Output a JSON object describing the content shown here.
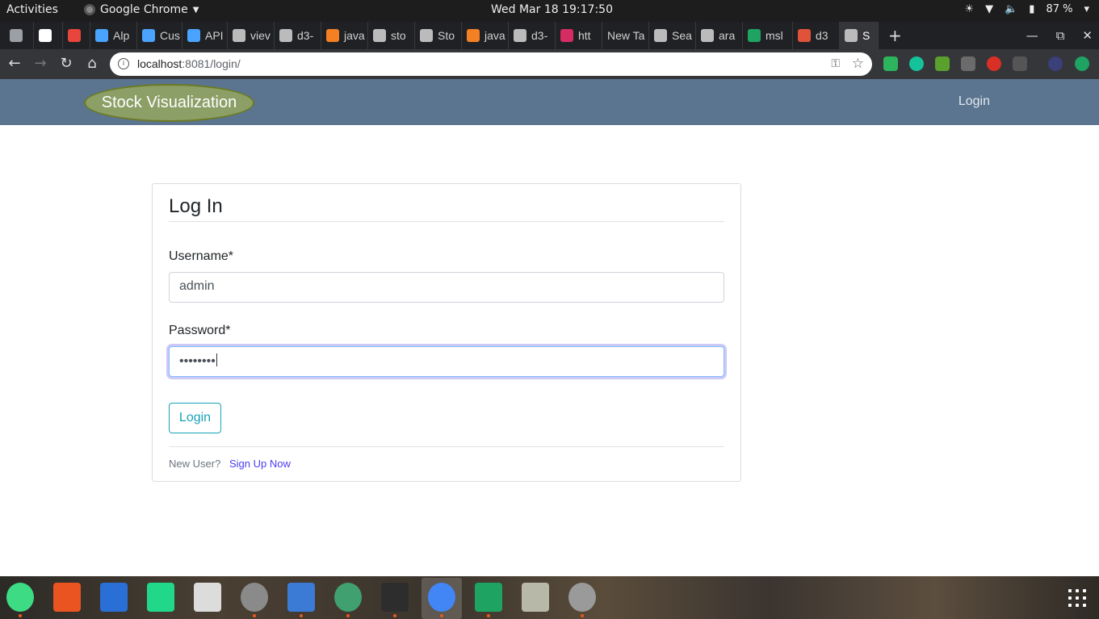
{
  "system_bar": {
    "activities": "Activities",
    "app_name": "Google Chrome",
    "clock": "Wed Mar 18  19:17:50",
    "battery": "87 %"
  },
  "tabs": [
    {
      "label": "",
      "icon": "reader-icon",
      "color": "#9aa0a6"
    },
    {
      "label": "",
      "icon": "google-icon",
      "color": "#ffffff"
    },
    {
      "label": "",
      "icon": "quora-icon",
      "color": "#e8453c"
    },
    {
      "label": "Alp",
      "icon": "atlassian-icon",
      "color": "#4aa3ff"
    },
    {
      "label": "Cus",
      "icon": "atlassian-icon",
      "color": "#4aa3ff"
    },
    {
      "label": "API",
      "icon": "atlassian-icon",
      "color": "#4aa3ff"
    },
    {
      "label": "viev",
      "icon": "globe-icon",
      "color": "#bbbbbb"
    },
    {
      "label": "d3-",
      "icon": "github-icon",
      "color": "#bbbbbb"
    },
    {
      "label": "java",
      "icon": "stackoverflow-icon",
      "color": "#f48024"
    },
    {
      "label": "sto",
      "icon": "github-icon",
      "color": "#bbbbbb"
    },
    {
      "label": "Sto",
      "icon": "globe-icon",
      "color": "#bbbbbb"
    },
    {
      "label": "java",
      "icon": "stackoverflow-icon",
      "color": "#f48024"
    },
    {
      "label": "d3-",
      "icon": "github-icon",
      "color": "#bbbbbb"
    },
    {
      "label": "htt",
      "icon": "webstorm-icon",
      "color": "#d62c64"
    },
    {
      "label": "New Ta",
      "icon": "",
      "color": ""
    },
    {
      "label": "Sea",
      "icon": "github-icon",
      "color": "#bbbbbb"
    },
    {
      "label": "ara",
      "icon": "github-icon",
      "color": "#bbbbbb"
    },
    {
      "label": "msl",
      "icon": "sheets-plus-icon",
      "color": "#1ea362"
    },
    {
      "label": "d3",
      "icon": "cube-icon",
      "color": "#e0533a"
    },
    {
      "label": "S",
      "icon": "globe-icon",
      "color": "#bbbbbb",
      "active": true
    }
  ],
  "browser": {
    "url_host": "localhost",
    "url_path": ":8081/login/"
  },
  "site": {
    "brand": "Stock Visualization",
    "nav_login": "Login"
  },
  "form": {
    "title": "Log In",
    "username_label": "Username*",
    "username_value": "admin",
    "password_label": "Password*",
    "password_value": "••••••••",
    "submit_label": "Login",
    "footer_text": "New User?",
    "signup_link": "Sign Up Now"
  },
  "colors": {
    "navbar": "#5b7590",
    "brand_bg": "#8b9f66",
    "outline_button": "#17a2b8",
    "link": "#4a3df0"
  },
  "dock_apps": [
    "android-studio-icon",
    "software-center-icon",
    "text-editor-icon",
    "pycharm-icon",
    "image-viewer-icon",
    "settings-icon",
    "files-icon",
    "atom-icon",
    "terminal-icon",
    "chrome-icon",
    "spreadsheet-icon",
    "file-manager-icon",
    "disks-icon"
  ]
}
